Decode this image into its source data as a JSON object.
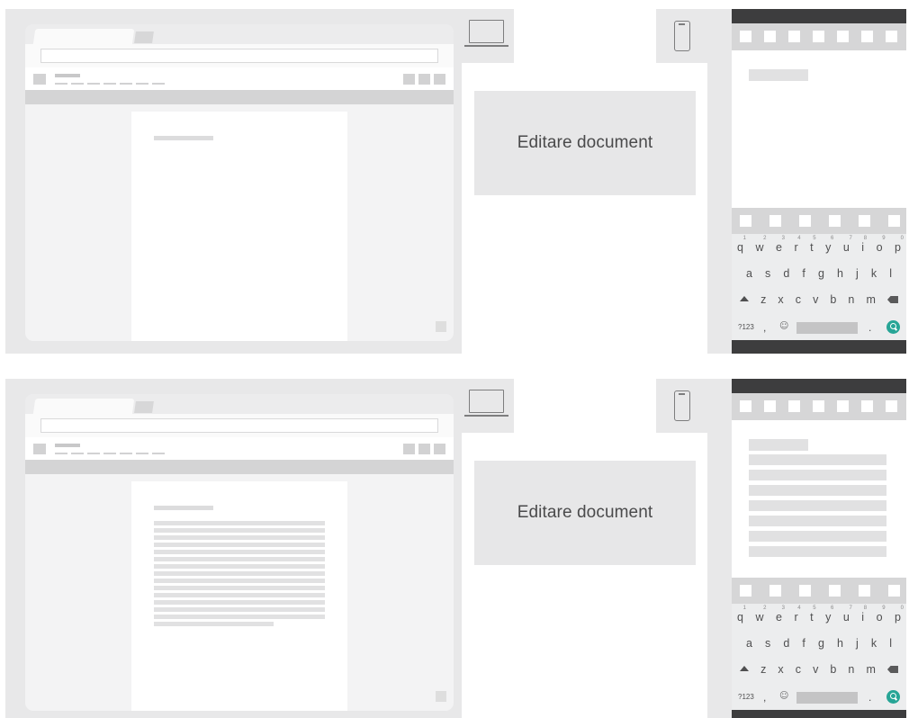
{
  "label": "Editare document",
  "keyboard": {
    "row1": [
      "q",
      "w",
      "e",
      "r",
      "t",
      "y",
      "u",
      "i",
      "o",
      "p"
    ],
    "row1_digits": [
      "1",
      "2",
      "3",
      "4",
      "5",
      "6",
      "7",
      "8",
      "9",
      "0"
    ],
    "row2": [
      "a",
      "s",
      "d",
      "f",
      "g",
      "h",
      "j",
      "k",
      "l"
    ],
    "row3": [
      "z",
      "x",
      "c",
      "v",
      "b",
      "n",
      "m"
    ],
    "symbols_key": "?123",
    "comma_key": ",",
    "period_key": "."
  },
  "icons": {
    "laptop": "laptop-icon",
    "phone": "phone-icon",
    "search": "search-icon",
    "shift": "shift-icon",
    "backspace": "backspace-icon",
    "emoji": "emoji-icon"
  },
  "colors": {
    "frame": "#e8e8e9",
    "label_bg": "#e7e7e8",
    "status_bar": "#3d3d3e",
    "search_accent": "#27a596"
  },
  "panels": [
    {
      "id": "empty",
      "doc_lines": 0,
      "phone_lines": 0
    },
    {
      "id": "filled",
      "doc_lines": 15,
      "phone_lines": 7
    }
  ]
}
